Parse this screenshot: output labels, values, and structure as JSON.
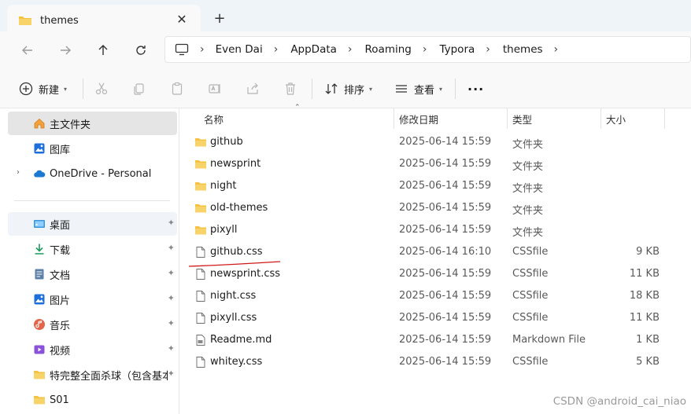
{
  "tab": {
    "title": "themes",
    "close_glyph": "✕",
    "new_tab_glyph": "+"
  },
  "address": {
    "crumbs": [
      "Even Dai",
      "AppData",
      "Roaming",
      "Typora",
      "themes"
    ],
    "sep_glyph": "›"
  },
  "toolbar": {
    "new_label": "新建",
    "sort_label": "排序",
    "view_label": "查看",
    "more_glyph": "···"
  },
  "sidebar": {
    "items": [
      {
        "label": "主文件夹",
        "icon": "home-icon"
      },
      {
        "label": "图库",
        "icon": "gallery-icon"
      },
      {
        "label": "OneDrive - Personal",
        "icon": "onedrive-icon"
      },
      {
        "label": "桌面",
        "icon": "desktop-icon"
      },
      {
        "label": "下载",
        "icon": "download-icon"
      },
      {
        "label": "文档",
        "icon": "documents-icon"
      },
      {
        "label": "图片",
        "icon": "pictures-icon"
      },
      {
        "label": "音乐",
        "icon": "music-icon"
      },
      {
        "label": "视频",
        "icon": "videos-icon"
      },
      {
        "label": "特完整全面杀球（包含基本:",
        "icon": "folder-icon"
      },
      {
        "label": "S01",
        "icon": "folder-icon"
      }
    ],
    "expander_glyph": "›",
    "pin_glyph": "📌"
  },
  "columns": {
    "name": "名称",
    "modified": "修改日期",
    "type": "类型",
    "size": "大小"
  },
  "files": [
    {
      "name": "github",
      "date": "2025-06-14 15:59",
      "type": "文件夹",
      "size": "",
      "kind": "folder"
    },
    {
      "name": "newsprint",
      "date": "2025-06-14 15:59",
      "type": "文件夹",
      "size": "",
      "kind": "folder"
    },
    {
      "name": "night",
      "date": "2025-06-14 15:59",
      "type": "文件夹",
      "size": "",
      "kind": "folder"
    },
    {
      "name": "old-themes",
      "date": "2025-06-14 15:59",
      "type": "文件夹",
      "size": "",
      "kind": "folder"
    },
    {
      "name": "pixyll",
      "date": "2025-06-14 15:59",
      "type": "文件夹",
      "size": "",
      "kind": "folder"
    },
    {
      "name": "github.css",
      "date": "2025-06-14 16:10",
      "type": "CSSfile",
      "size": "9 KB",
      "kind": "file"
    },
    {
      "name": "newsprint.css",
      "date": "2025-06-14 15:59",
      "type": "CSSfile",
      "size": "11 KB",
      "kind": "file"
    },
    {
      "name": "night.css",
      "date": "2025-06-14 15:59",
      "type": "CSSfile",
      "size": "18 KB",
      "kind": "file"
    },
    {
      "name": "pixyll.css",
      "date": "2025-06-14 15:59",
      "type": "CSSfile",
      "size": "11 KB",
      "kind": "file"
    },
    {
      "name": "Readme.md",
      "date": "2025-06-14 15:59",
      "type": "Markdown File",
      "size": "1 KB",
      "kind": "md"
    },
    {
      "name": "whitey.css",
      "date": "2025-06-14 15:59",
      "type": "CSSfile",
      "size": "5 KB",
      "kind": "file"
    }
  ],
  "watermark": "CSDN @android_cai_niao",
  "colors": {
    "folder": "#f5c242",
    "accent": "#0067c0",
    "annotation": "#d11a1a"
  }
}
